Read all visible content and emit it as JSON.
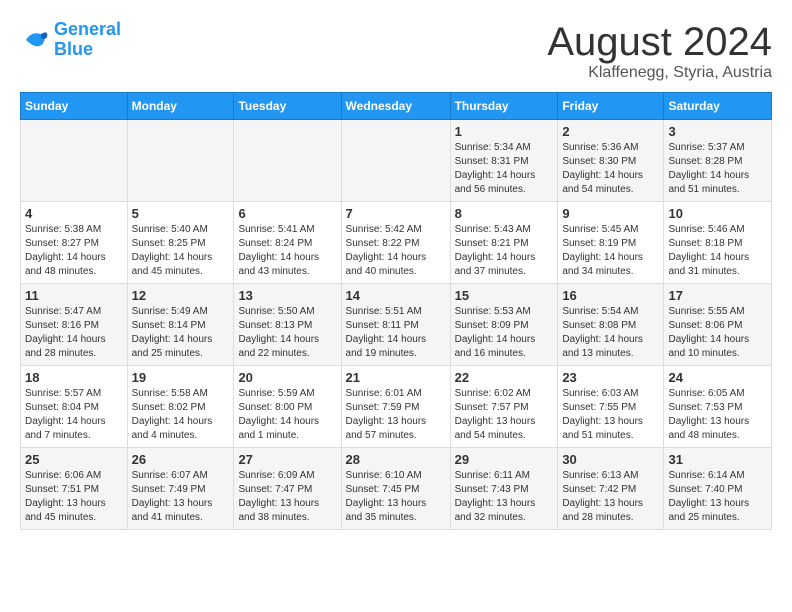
{
  "logo": {
    "text_general": "General",
    "text_blue": "Blue"
  },
  "title": "August 2024",
  "location": "Klaffenegg, Styria, Austria",
  "headers": [
    "Sunday",
    "Monday",
    "Tuesday",
    "Wednesday",
    "Thursday",
    "Friday",
    "Saturday"
  ],
  "weeks": [
    {
      "days": [
        {
          "number": "",
          "info": ""
        },
        {
          "number": "",
          "info": ""
        },
        {
          "number": "",
          "info": ""
        },
        {
          "number": "",
          "info": ""
        },
        {
          "number": "1",
          "info": "Sunrise: 5:34 AM\nSunset: 8:31 PM\nDaylight: 14 hours\nand 56 minutes."
        },
        {
          "number": "2",
          "info": "Sunrise: 5:36 AM\nSunset: 8:30 PM\nDaylight: 14 hours\nand 54 minutes."
        },
        {
          "number": "3",
          "info": "Sunrise: 5:37 AM\nSunset: 8:28 PM\nDaylight: 14 hours\nand 51 minutes."
        }
      ]
    },
    {
      "days": [
        {
          "number": "4",
          "info": "Sunrise: 5:38 AM\nSunset: 8:27 PM\nDaylight: 14 hours\nand 48 minutes."
        },
        {
          "number": "5",
          "info": "Sunrise: 5:40 AM\nSunset: 8:25 PM\nDaylight: 14 hours\nand 45 minutes."
        },
        {
          "number": "6",
          "info": "Sunrise: 5:41 AM\nSunset: 8:24 PM\nDaylight: 14 hours\nand 43 minutes."
        },
        {
          "number": "7",
          "info": "Sunrise: 5:42 AM\nSunset: 8:22 PM\nDaylight: 14 hours\nand 40 minutes."
        },
        {
          "number": "8",
          "info": "Sunrise: 5:43 AM\nSunset: 8:21 PM\nDaylight: 14 hours\nand 37 minutes."
        },
        {
          "number": "9",
          "info": "Sunrise: 5:45 AM\nSunset: 8:19 PM\nDaylight: 14 hours\nand 34 minutes."
        },
        {
          "number": "10",
          "info": "Sunrise: 5:46 AM\nSunset: 8:18 PM\nDaylight: 14 hours\nand 31 minutes."
        }
      ]
    },
    {
      "days": [
        {
          "number": "11",
          "info": "Sunrise: 5:47 AM\nSunset: 8:16 PM\nDaylight: 14 hours\nand 28 minutes."
        },
        {
          "number": "12",
          "info": "Sunrise: 5:49 AM\nSunset: 8:14 PM\nDaylight: 14 hours\nand 25 minutes."
        },
        {
          "number": "13",
          "info": "Sunrise: 5:50 AM\nSunset: 8:13 PM\nDaylight: 14 hours\nand 22 minutes."
        },
        {
          "number": "14",
          "info": "Sunrise: 5:51 AM\nSunset: 8:11 PM\nDaylight: 14 hours\nand 19 minutes."
        },
        {
          "number": "15",
          "info": "Sunrise: 5:53 AM\nSunset: 8:09 PM\nDaylight: 14 hours\nand 16 minutes."
        },
        {
          "number": "16",
          "info": "Sunrise: 5:54 AM\nSunset: 8:08 PM\nDaylight: 14 hours\nand 13 minutes."
        },
        {
          "number": "17",
          "info": "Sunrise: 5:55 AM\nSunset: 8:06 PM\nDaylight: 14 hours\nand 10 minutes."
        }
      ]
    },
    {
      "days": [
        {
          "number": "18",
          "info": "Sunrise: 5:57 AM\nSunset: 8:04 PM\nDaylight: 14 hours\nand 7 minutes."
        },
        {
          "number": "19",
          "info": "Sunrise: 5:58 AM\nSunset: 8:02 PM\nDaylight: 14 hours\nand 4 minutes."
        },
        {
          "number": "20",
          "info": "Sunrise: 5:59 AM\nSunset: 8:00 PM\nDaylight: 14 hours\nand 1 minute."
        },
        {
          "number": "21",
          "info": "Sunrise: 6:01 AM\nSunset: 7:59 PM\nDaylight: 13 hours\nand 57 minutes."
        },
        {
          "number": "22",
          "info": "Sunrise: 6:02 AM\nSunset: 7:57 PM\nDaylight: 13 hours\nand 54 minutes."
        },
        {
          "number": "23",
          "info": "Sunrise: 6:03 AM\nSunset: 7:55 PM\nDaylight: 13 hours\nand 51 minutes."
        },
        {
          "number": "24",
          "info": "Sunrise: 6:05 AM\nSunset: 7:53 PM\nDaylight: 13 hours\nand 48 minutes."
        }
      ]
    },
    {
      "days": [
        {
          "number": "25",
          "info": "Sunrise: 6:06 AM\nSunset: 7:51 PM\nDaylight: 13 hours\nand 45 minutes."
        },
        {
          "number": "26",
          "info": "Sunrise: 6:07 AM\nSunset: 7:49 PM\nDaylight: 13 hours\nand 41 minutes."
        },
        {
          "number": "27",
          "info": "Sunrise: 6:09 AM\nSunset: 7:47 PM\nDaylight: 13 hours\nand 38 minutes."
        },
        {
          "number": "28",
          "info": "Sunrise: 6:10 AM\nSunset: 7:45 PM\nDaylight: 13 hours\nand 35 minutes."
        },
        {
          "number": "29",
          "info": "Sunrise: 6:11 AM\nSunset: 7:43 PM\nDaylight: 13 hours\nand 32 minutes."
        },
        {
          "number": "30",
          "info": "Sunrise: 6:13 AM\nSunset: 7:42 PM\nDaylight: 13 hours\nand 28 minutes."
        },
        {
          "number": "31",
          "info": "Sunrise: 6:14 AM\nSunset: 7:40 PM\nDaylight: 13 hours\nand 25 minutes."
        }
      ]
    }
  ]
}
